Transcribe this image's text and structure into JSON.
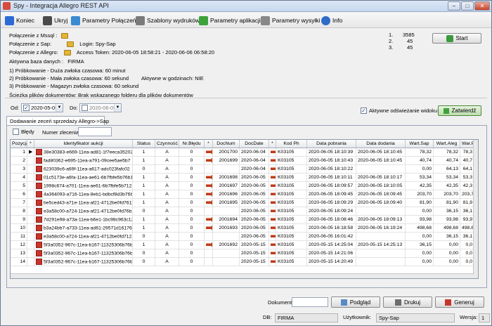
{
  "window": {
    "title": "Spy - Integracja Allegro REST API"
  },
  "toolbar": {
    "koniec": "Koniec",
    "ukryj": "Ukryj",
    "parametry_polaczen": "Parametry Połączeń",
    "szablony": "Szablony wydruków",
    "parametry_aplikacji": "Parametry aplikacji",
    "parametry_wysylki": "Parametry wysyłki",
    "info": "Info"
  },
  "info": {
    "mssql": "Połączenie z Mssql :",
    "sap": "Połączenie z Sap:",
    "allegro": "Połączenie z Allegro:",
    "login": "Login:  Spy-Sap",
    "token": "Access Token: 2020-06-05 18:58:21 - 2020-06-06 06:58:20",
    "baza_label": "Aktywna baza danych :",
    "baza_value": "FIRMA",
    "prob1": "1) Próbkowanie - Duża zwłoka czasowa:   60   minut",
    "prob2": "2) Próbkowanie - Mała zwłoka czasowa:   60   sekund",
    "godziny": "Aktywne w godzinach:  NIE",
    "prob3": "3) Próbkowanie - Magazyn zwłoka czasowa:   60   sekund",
    "sciezka": "Ścieżka plików dokumentów:   Brak wskazanego folderu dla plików dokumentów"
  },
  "stats": {
    "l1": "1.",
    "v1": "3585",
    "l2": "2.",
    "v2": "45",
    "l3": "3.",
    "v3": "45"
  },
  "start_label": "Start",
  "filters": {
    "od_label": "Od:",
    "od_value": "2020-05-05",
    "do_label": "Do:",
    "do_value": "2020-06-05",
    "auto_refresh": "Aktywne odświeżanie widoku",
    "approve": "Zatwierdź",
    "bledy": "Błędy",
    "numer_label": "Numer zlecenia:"
  },
  "tab": "Dodawanie zeceń sprzedaży Allegro->Sap",
  "columns": [
    "Pozycja",
    "*",
    "Identyfikator aukcji",
    "Status",
    "Czynność",
    "Nr.Błędu",
    "*",
    "DocNum",
    "DocDate",
    "*",
    "Kod Ph",
    "Data pobrania",
    "Data dodania",
    "Wart.Sap",
    "Wart.Aleg",
    "War.Po"
  ],
  "rows": [
    {
      "pos": "1",
      "id": "38e30383-e669-11ea-ad81-1f7eeca35202",
      "st": "1",
      "cz": "A",
      "err": "0",
      "a1": true,
      "doc": "2001700",
      "dd": "2020-06-04",
      "a2": true,
      "kod": "K03105",
      "dp": "2020-06-05 18:10:39",
      "da": "2020-06-05 18:10:45",
      "ws": "78,32",
      "wa": "78,32",
      "wp": "78,3"
    },
    {
      "pos": "2",
      "id": "fad80362-e695-11ea-a791-09cee5ae5b7",
      "st": "1",
      "cz": "A",
      "err": "0",
      "a1": true,
      "doc": "2001699",
      "dd": "2020-06-04",
      "a2": true,
      "kod": "K03105",
      "dp": "2020-06-05 18:10:43",
      "da": "2020-06-05 18:10:45",
      "ws": "40,74",
      "wa": "40,74",
      "wp": "40,7"
    },
    {
      "pos": "3",
      "id": "623039c6-a69f-11ea-a617-adc023fafc02",
      "st": "0",
      "cz": "A",
      "err": "0",
      "a1": false,
      "doc": "",
      "dd": "2020-06-04",
      "a2": true,
      "kod": "K03105",
      "dp": "2020-06-05 18:10:22",
      "da": "",
      "ws": "0,00",
      "wa": "64,13",
      "wp": "64,1"
    },
    {
      "pos": "4",
      "id": "01c5173e-a6fa-11ea-ae61-6b7fbfe5b76b1",
      "st": "1",
      "cz": "A",
      "err": "0",
      "a1": true,
      "doc": "2001698",
      "dd": "2020-06-05",
      "a2": true,
      "kod": "K03105",
      "dp": "2020-06-05 18:10:11",
      "da": "2020-06-05 18:10:17",
      "ws": "53,34",
      "wa": "53,34",
      "wp": "53,3"
    },
    {
      "pos": "5",
      "id": "1998c674-a701-11ea-ae61-6b7fbfe5b712",
      "st": "1",
      "cz": "A",
      "err": "0",
      "a1": true,
      "doc": "2001697",
      "dd": "2020-06-05",
      "a2": true,
      "kod": "K03105",
      "dp": "2020-06-05 18:09:57",
      "da": "2020-06-05 18:10:05",
      "ws": "42,35",
      "wa": "42,35",
      "wp": "42,3"
    },
    {
      "pos": "6",
      "id": "4a364093-a716-11ea-8eb1-bdbcf8d3b76b",
      "st": "1",
      "cz": "A",
      "err": "0",
      "a1": true,
      "doc": "2001696",
      "dd": "2020-06-05",
      "a2": true,
      "kod": "K03105",
      "dp": "2020-06-05 18:09:45",
      "da": "2020-06-05 18:09:45",
      "ws": "203,70",
      "wa": "203,70",
      "wp": "203,7"
    },
    {
      "pos": "7",
      "id": "be5ced43-a71e-11ea-af21-4712be0fd7611",
      "st": "1",
      "cz": "A",
      "err": "0",
      "a1": true,
      "doc": "2001695",
      "dd": "2020-06-05",
      "a2": true,
      "kod": "K03105",
      "dp": "2020-06-05 18:09:29",
      "da": "2020-06-05 18:09:40",
      "ws": "81,90",
      "wa": "81,90",
      "wp": "81,9"
    },
    {
      "pos": "8",
      "id": "e3a58c00-a724-11ea-af21-4712be0fd76b1",
      "st": "0",
      "cz": "A",
      "err": "0",
      "a1": false,
      "doc": "",
      "dd": "2020-06-05",
      "a2": true,
      "kod": "K03105",
      "dp": "2020-06-05 18:09:24",
      "da": "",
      "ws": "0,00",
      "wa": "36,15",
      "wp": "36,1"
    },
    {
      "pos": "9",
      "id": "7d291e98-a73a-11ea-b6e1-1bc98c963c12",
      "st": "1",
      "cz": "A",
      "err": "0",
      "a1": true,
      "doc": "2001694",
      "dd": "2020-06-05",
      "a2": true,
      "kod": "K03105",
      "dp": "2020-06-05 18:08:46",
      "da": "2020-06-05 18:09:13",
      "ws": "93,98",
      "wa": "93,98",
      "wp": "93,9"
    },
    {
      "pos": "10",
      "id": "b3a24bb7-a733-11ea-ad61-29571d16176b",
      "st": "1",
      "cz": "A",
      "err": "0",
      "a1": true,
      "doc": "2001693",
      "dd": "2020-06-05",
      "a2": true,
      "kod": "K03105",
      "dp": "2020-06-05 16:18:58",
      "da": "2020-06-05 16:19:24",
      "ws": "498,68",
      "wa": "498,68",
      "wp": "498,6"
    },
    {
      "pos": "11",
      "id": "e3a58c00-a724-11ea-af21-4712be0fd7121",
      "st": "0",
      "cz": "A",
      "err": "0",
      "a1": false,
      "doc": "",
      "dd": "2020-06-05",
      "a2": true,
      "kod": "K03105",
      "dp": "2020-06-05 16:01:42",
      "da": "",
      "ws": "0,00",
      "wa": "36,15",
      "wp": "36,1"
    },
    {
      "pos": "12",
      "id": "5f3a0352-967c-11ea-b167-11325306b76b",
      "st": "1",
      "cz": "A",
      "err": "0",
      "a1": true,
      "doc": "2001692",
      "dd": "2020-05-15",
      "a2": true,
      "kod": "K03105",
      "dp": "2020-05-15 14:25:04",
      "da": "2020-05-15 14:25:13",
      "ws": "36,15",
      "wa": "0,00",
      "wp": "0,0"
    },
    {
      "pos": "13",
      "id": "5f3a0352-967c-11ea-b167-11325306b76b",
      "st": "0",
      "cz": "A",
      "err": "0",
      "a1": false,
      "doc": "",
      "dd": "2020-05-15",
      "a2": true,
      "kod": "K03105",
      "dp": "2020-05-15 14:21:06",
      "da": "",
      "ws": "0,00",
      "wa": "0,00",
      "wp": "0,0"
    },
    {
      "pos": "14",
      "id": "5f3a0352-967c-11ea-b167-11325306b76b",
      "st": "0",
      "cz": "A",
      "err": "0",
      "a1": false,
      "doc": "",
      "dd": "2020-05-15",
      "a2": true,
      "kod": "K03105",
      "dp": "2020-05-15 14:20:49",
      "da": "",
      "ws": "0,00",
      "wa": "0,00",
      "wp": "0,0"
    }
  ],
  "bottom": {
    "dokument": "Dokument:",
    "podglad": "Podgląd",
    "drukuj": "Drukuj",
    "generuj": "Generuj"
  },
  "status": {
    "db_label": "DB:",
    "db_value": "FIRMA",
    "user_label": "Użytkownik:",
    "user_value": "Spy-Sap",
    "ver_label": "Wersja:",
    "ver_value": "1"
  },
  "colors": {
    "accent": "#2e6cc6",
    "toolbar_bg": "#ececec",
    "pdf": "#c8352b",
    "arrow": "#c03a16"
  }
}
